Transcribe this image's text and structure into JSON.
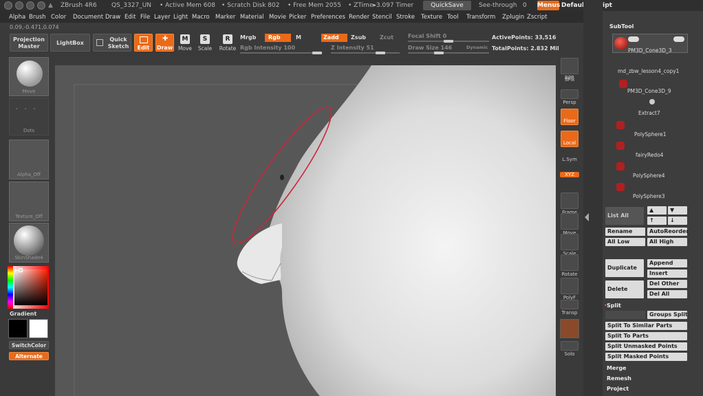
{
  "titlebar": {
    "app": "ZBrush 4R6",
    "doc": "QS_3327_UN",
    "active_mem": "• Active Mem 608",
    "scratch": "• Scratch Disk 802",
    "free_mem": "• Free Mem 2055",
    "ztime": "• ZTime▸3.097 Timer",
    "quicksave": "QuickSave",
    "seethrough": "See-through",
    "seethrough_val": "0",
    "menus": "Menus",
    "script": "DefaultZScript"
  },
  "menu": [
    "Alpha",
    "Brush",
    "Color",
    "Document",
    "Draw",
    "Edit",
    "File",
    "Layer",
    "Light",
    "Macro",
    "Marker",
    "Material",
    "Movie",
    "Picker",
    "Preferences",
    "Render",
    "Stencil",
    "Stroke",
    "Texture",
    "Tool",
    "Transform",
    "Zplugin",
    "Zscript"
  ],
  "coords": "0.09,-0.471,0.074",
  "topbar": {
    "projection_master": "Projection Master",
    "lightbox": "LightBox",
    "quick_sketch": "Quick Sketch",
    "edit": "Edit",
    "draw": "Draw",
    "move": "Move",
    "scale": "Scale",
    "rotate": "Rotate",
    "mrgb": "Mrgb",
    "rgb": "Rgb",
    "m": "M",
    "zadd": "Zadd",
    "zsub": "Zsub",
    "zcut": "Zcut",
    "rgb_intensity": "Rgb Intensity 100",
    "z_intensity": "Z Intensity 51",
    "focal_shift": "Focal Shift 0",
    "draw_size": "Draw Size 146",
    "dynamic": "Dynamic",
    "active_points": "ActivePoints: 33,516",
    "total_points": "TotalPoints: 2.832 Mil"
  },
  "leftshelf": {
    "brush_cap": "Move",
    "stroke_cap": "Dots",
    "alpha_cap": "Alpha_Off",
    "texture_cap": "Texture_Off",
    "material_cap": "SkinShade4",
    "gradient": "Gradient",
    "switchcolor": "SwitchColor",
    "alternate": "Alternate"
  },
  "righttools": [
    "BPR",
    "SPix",
    "Persp",
    "Floor",
    "Local",
    "L.Sym",
    "XYZ",
    "Frame",
    "Move",
    "Scale",
    "Rotate",
    "PolyF",
    "Transp",
    "Solo"
  ],
  "subtool": {
    "header": "SubTool",
    "items": [
      "PM3D_Cone3D_3",
      "md_zbw_lesson4_copy1",
      "PM3D_Cone3D_9",
      "Extract7",
      "PolySphere1",
      "fairyRedo4",
      "PolySphere4",
      "PolySphere3"
    ]
  },
  "panel": {
    "list_all": "List All",
    "rename": "Rename",
    "autoreorder": "AutoReorder",
    "all_low": "All Low",
    "all_high": "All High",
    "duplicate": "Duplicate",
    "append": "Append",
    "insert": "Insert",
    "delete": "Delete",
    "del_other": "Del Other",
    "del_all": "Del All",
    "split": "Split",
    "groups_split": "Groups Split",
    "split_similar": "Split To Similar Parts",
    "split_parts": "Split To Parts",
    "split_unmasked": "Split Unmasked Points",
    "split_masked": "Split Masked Points",
    "merge": "Merge",
    "remesh": "Remesh",
    "project": "Project"
  },
  "colors": {
    "accent": "#ea6a1a",
    "selection_ring": "#c8283a"
  }
}
